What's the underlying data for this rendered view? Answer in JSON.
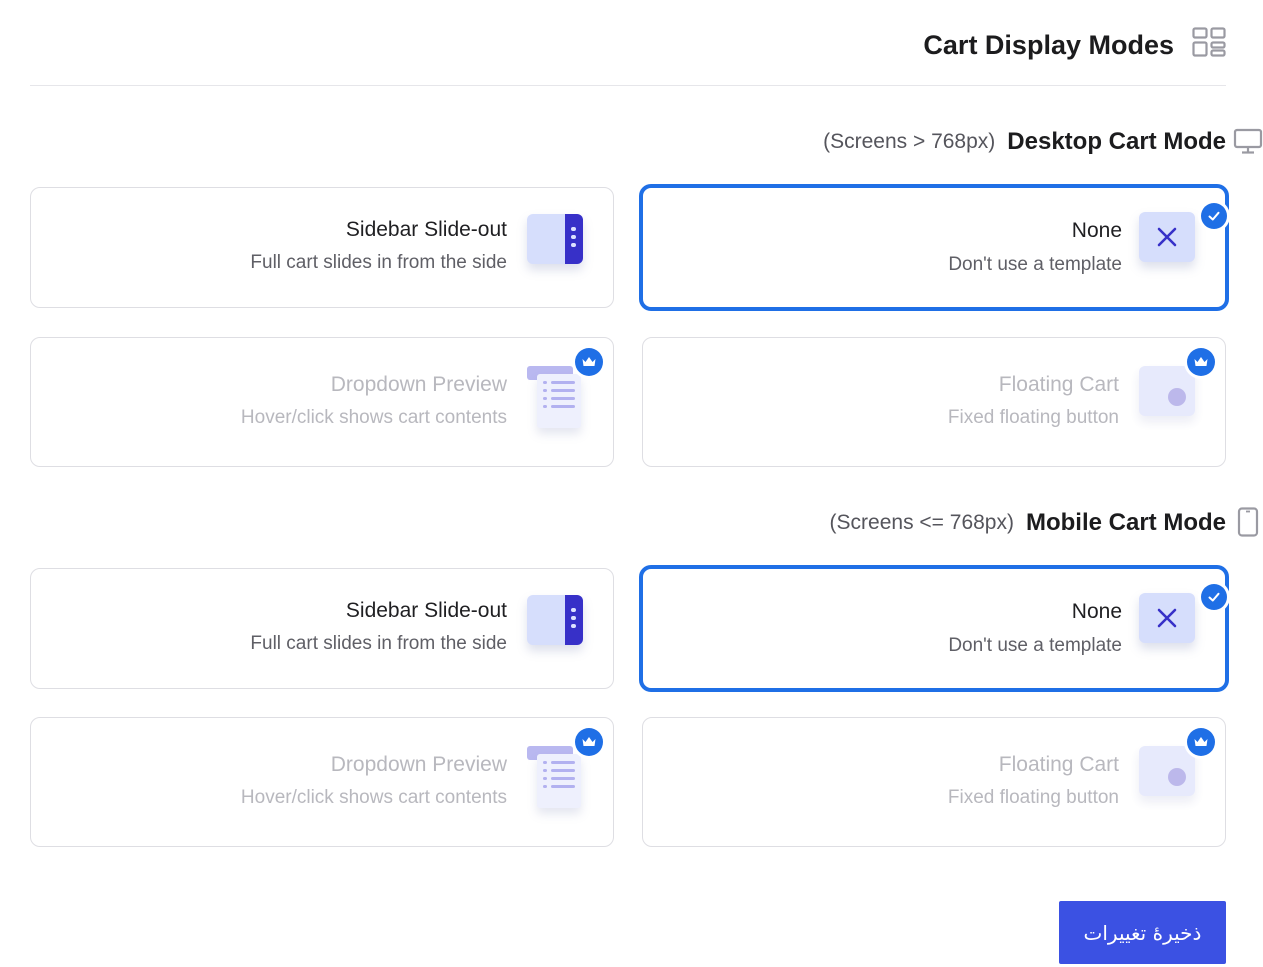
{
  "header": {
    "title": "Cart Display Modes",
    "icon": "layout-grid-icon"
  },
  "desktop": {
    "note": "(Screens > 768px)",
    "title": "Desktop Cart Mode",
    "icon": "monitor-icon",
    "options": [
      {
        "title": "Sidebar Slide-out",
        "desc": "Full cart slides in from the side",
        "icon": "sidebar-panel-icon",
        "state": "default"
      },
      {
        "title": "None",
        "desc": "Don't use a template",
        "icon": "close-icon",
        "state": "selected"
      },
      {
        "title": "Dropdown Preview",
        "desc": "Hover/click shows cart contents",
        "icon": "dropdown-list-icon",
        "state": "premium"
      },
      {
        "title": "Floating Cart",
        "desc": "Fixed floating button",
        "icon": "floating-button-icon",
        "state": "premium"
      }
    ]
  },
  "mobile": {
    "note": "(Screens <= 768px)",
    "title": "Mobile Cart Mode",
    "icon": "smartphone-icon",
    "options": [
      {
        "title": "Sidebar Slide-out",
        "desc": "Full cart slides in from the side",
        "icon": "sidebar-panel-icon",
        "state": "default"
      },
      {
        "title": "None",
        "desc": "Don't use a template",
        "icon": "close-icon",
        "state": "selected"
      },
      {
        "title": "Dropdown Preview",
        "desc": "Hover/click shows cart contents",
        "icon": "dropdown-list-icon",
        "state": "premium"
      },
      {
        "title": "Floating Cart",
        "desc": "Fixed floating button",
        "icon": "floating-button-icon",
        "state": "premium"
      }
    ]
  },
  "save_label": "ذخیرهٔ تغییرات",
  "colors": {
    "accent": "#1f6fe6",
    "button": "#3b51e3",
    "icon_dark": "#3730c8",
    "icon_light": "#d6defc"
  }
}
